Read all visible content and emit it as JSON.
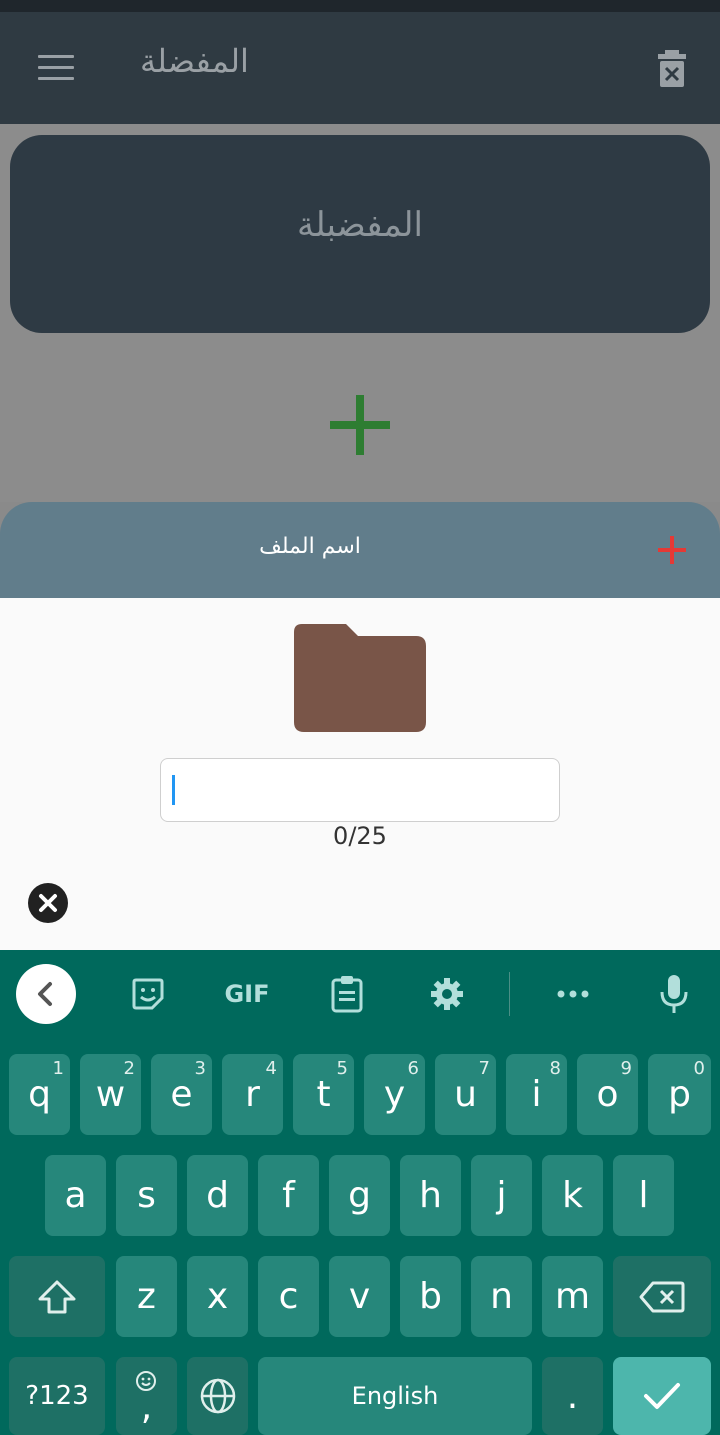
{
  "app": {
    "title": "المفضلة",
    "menu_icon": "menu-icon",
    "delete_icon": "trash-icon"
  },
  "favorites_card": {
    "label": "المفضبلة"
  },
  "add_button": {
    "icon": "plus-icon",
    "color": "#2e7d32"
  },
  "dialog": {
    "title": "اسم الملف",
    "add_icon": "plus-icon",
    "add_color": "#e53935",
    "folder_icon": "folder-icon",
    "folder_color": "#795548",
    "input": {
      "value": "",
      "placeholder": ""
    },
    "counter": "0/25",
    "close_icon": "close-icon"
  },
  "keyboard": {
    "toolbar": [
      {
        "name": "back",
        "icon": "chevron-left-icon"
      },
      {
        "name": "sticker",
        "icon": "sticker-icon"
      },
      {
        "name": "gif",
        "label": "GIF"
      },
      {
        "name": "clipboard",
        "icon": "clipboard-icon"
      },
      {
        "name": "settings",
        "icon": "gear-icon"
      },
      {
        "name": "more",
        "icon": "more-icon"
      },
      {
        "name": "mic",
        "icon": "mic-icon"
      }
    ],
    "row1": [
      {
        "label": "q",
        "hint": "1"
      },
      {
        "label": "w",
        "hint": "2"
      },
      {
        "label": "e",
        "hint": "3"
      },
      {
        "label": "r",
        "hint": "4"
      },
      {
        "label": "t",
        "hint": "5"
      },
      {
        "label": "y",
        "hint": "6"
      },
      {
        "label": "u",
        "hint": "7"
      },
      {
        "label": "i",
        "hint": "8"
      },
      {
        "label": "o",
        "hint": "9"
      },
      {
        "label": "p",
        "hint": "0"
      }
    ],
    "row2": [
      "a",
      "s",
      "d",
      "f",
      "g",
      "h",
      "j",
      "k",
      "l"
    ],
    "row3": [
      "z",
      "x",
      "c",
      "v",
      "b",
      "n",
      "m"
    ],
    "symbols_label": "?123",
    "comma_label": ",",
    "space_label": "English",
    "period_label": ".",
    "colors": {
      "background": "#00695c",
      "key": "#26877b",
      "action": "#4db6ac"
    }
  }
}
